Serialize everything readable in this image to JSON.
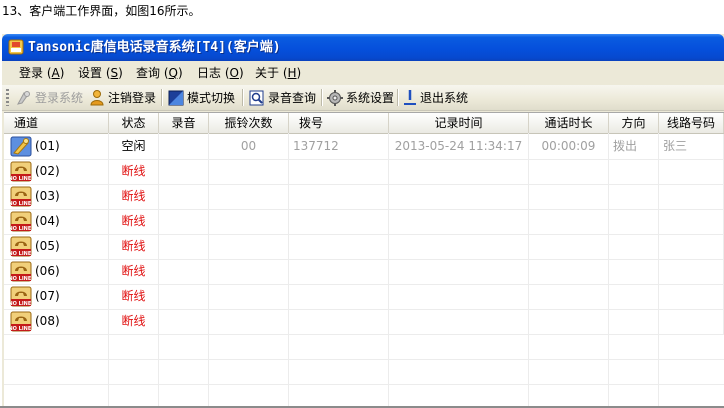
{
  "caption": "13、客户端工作界面，如图16所示。",
  "window": {
    "title": "Tansonic唐信电话录音系统[T4](客户端)",
    "icon": "app-icon"
  },
  "menu": [
    {
      "label": "登录",
      "accel": "A"
    },
    {
      "label": "设置",
      "accel": "S"
    },
    {
      "label": "查询",
      "accel": "Q"
    },
    {
      "label": "日志",
      "accel": "O"
    },
    {
      "label": "关于",
      "accel": "H"
    }
  ],
  "toolbar": [
    {
      "label": "登录系统",
      "icon": "login-icon",
      "enabled": false
    },
    {
      "label": "注销登录",
      "icon": "logout-user-icon",
      "enabled": true
    },
    {
      "label": "模式切换",
      "icon": "mode-switch-icon",
      "enabled": true
    },
    {
      "label": "录音查询",
      "icon": "search-record-icon",
      "enabled": true
    },
    {
      "label": "系统设置",
      "icon": "settings-icon",
      "enabled": true
    },
    {
      "label": "退出系统",
      "icon": "exit-icon",
      "enabled": true
    }
  ],
  "columns": [
    "通道",
    "状态",
    "录音",
    "振铃次数",
    "拨号",
    "记录时间",
    "通话时长",
    "方向",
    "线路号码"
  ],
  "rows": [
    {
      "channel": "(01)",
      "icon": "phone-connected-icon",
      "status": "空闲",
      "status_type": "idle",
      "recording": "",
      "rings": "00",
      "dialed": "137712",
      "time": "2013-05-24 11:34:17",
      "duration": "00:00:09",
      "direction": "拨出",
      "line": "张三"
    },
    {
      "channel": "(02)",
      "icon": "no-line-icon",
      "status": "断线",
      "status_type": "offline",
      "recording": "",
      "rings": "",
      "dialed": "",
      "time": "",
      "duration": "",
      "direction": "",
      "line": ""
    },
    {
      "channel": "(03)",
      "icon": "no-line-icon",
      "status": "断线",
      "status_type": "offline",
      "recording": "",
      "rings": "",
      "dialed": "",
      "time": "",
      "duration": "",
      "direction": "",
      "line": ""
    },
    {
      "channel": "(04)",
      "icon": "no-line-icon",
      "status": "断线",
      "status_type": "offline",
      "recording": "",
      "rings": "",
      "dialed": "",
      "time": "",
      "duration": "",
      "direction": "",
      "line": ""
    },
    {
      "channel": "(05)",
      "icon": "no-line-icon",
      "status": "断线",
      "status_type": "offline",
      "recording": "",
      "rings": "",
      "dialed": "",
      "time": "",
      "duration": "",
      "direction": "",
      "line": ""
    },
    {
      "channel": "(06)",
      "icon": "no-line-icon",
      "status": "断线",
      "status_type": "offline",
      "recording": "",
      "rings": "",
      "dialed": "",
      "time": "",
      "duration": "",
      "direction": "",
      "line": ""
    },
    {
      "channel": "(07)",
      "icon": "no-line-icon",
      "status": "断线",
      "status_type": "offline",
      "recording": "",
      "rings": "",
      "dialed": "",
      "time": "",
      "duration": "",
      "direction": "",
      "line": ""
    },
    {
      "channel": "(08)",
      "icon": "no-line-icon",
      "status": "断线",
      "status_type": "offline",
      "recording": "",
      "rings": "",
      "dialed": "",
      "time": "",
      "duration": "",
      "direction": "",
      "line": ""
    }
  ],
  "no_line_badge": "NO LINE!",
  "colors": {
    "title_bar": "#0550dc",
    "offline_text": "#e01010",
    "muted_text": "#a0a0a0",
    "window_bg": "#ece9d8"
  }
}
